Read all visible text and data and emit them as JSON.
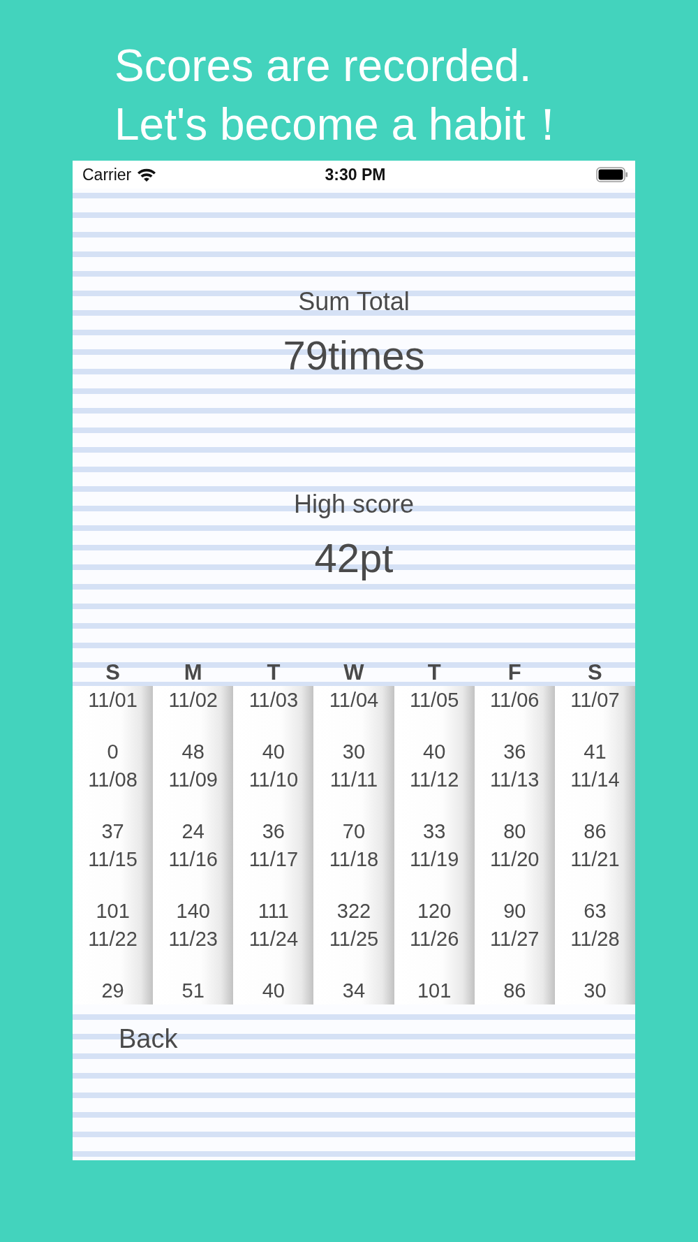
{
  "headline": [
    "Scores are recorded.",
    "Let's become a habit！"
  ],
  "status_bar": {
    "carrier": "Carrier",
    "time": "3:30 PM"
  },
  "sum_total": {
    "label": "Sum Total",
    "value": "79times"
  },
  "high_score": {
    "label": "High score",
    "value": "42pt"
  },
  "calendar": {
    "weekdays": [
      "S",
      "M",
      "T",
      "W",
      "T",
      "F",
      "S"
    ],
    "days": [
      {
        "date": "11/01",
        "score": "0"
      },
      {
        "date": "11/02",
        "score": "48"
      },
      {
        "date": "11/03",
        "score": "40"
      },
      {
        "date": "11/04",
        "score": "30"
      },
      {
        "date": "11/05",
        "score": "40"
      },
      {
        "date": "11/06",
        "score": "36"
      },
      {
        "date": "11/07",
        "score": "41"
      },
      {
        "date": "11/08",
        "score": "37"
      },
      {
        "date": "11/09",
        "score": "24"
      },
      {
        "date": "11/10",
        "score": "36"
      },
      {
        "date": "11/11",
        "score": "70"
      },
      {
        "date": "11/12",
        "score": "33"
      },
      {
        "date": "11/13",
        "score": "80"
      },
      {
        "date": "11/14",
        "score": "86"
      },
      {
        "date": "11/15",
        "score": "101"
      },
      {
        "date": "11/16",
        "score": "140"
      },
      {
        "date": "11/17",
        "score": "111"
      },
      {
        "date": "11/18",
        "score": "322"
      },
      {
        "date": "11/19",
        "score": "120"
      },
      {
        "date": "11/20",
        "score": "90"
      },
      {
        "date": "11/21",
        "score": "63"
      },
      {
        "date": "11/22",
        "score": "29"
      },
      {
        "date": "11/23",
        "score": "51"
      },
      {
        "date": "11/24",
        "score": "40"
      },
      {
        "date": "11/25",
        "score": "34"
      },
      {
        "date": "11/26",
        "score": "101"
      },
      {
        "date": "11/27",
        "score": "86"
      },
      {
        "date": "11/28",
        "score": "30"
      }
    ]
  },
  "back_button": "Back"
}
